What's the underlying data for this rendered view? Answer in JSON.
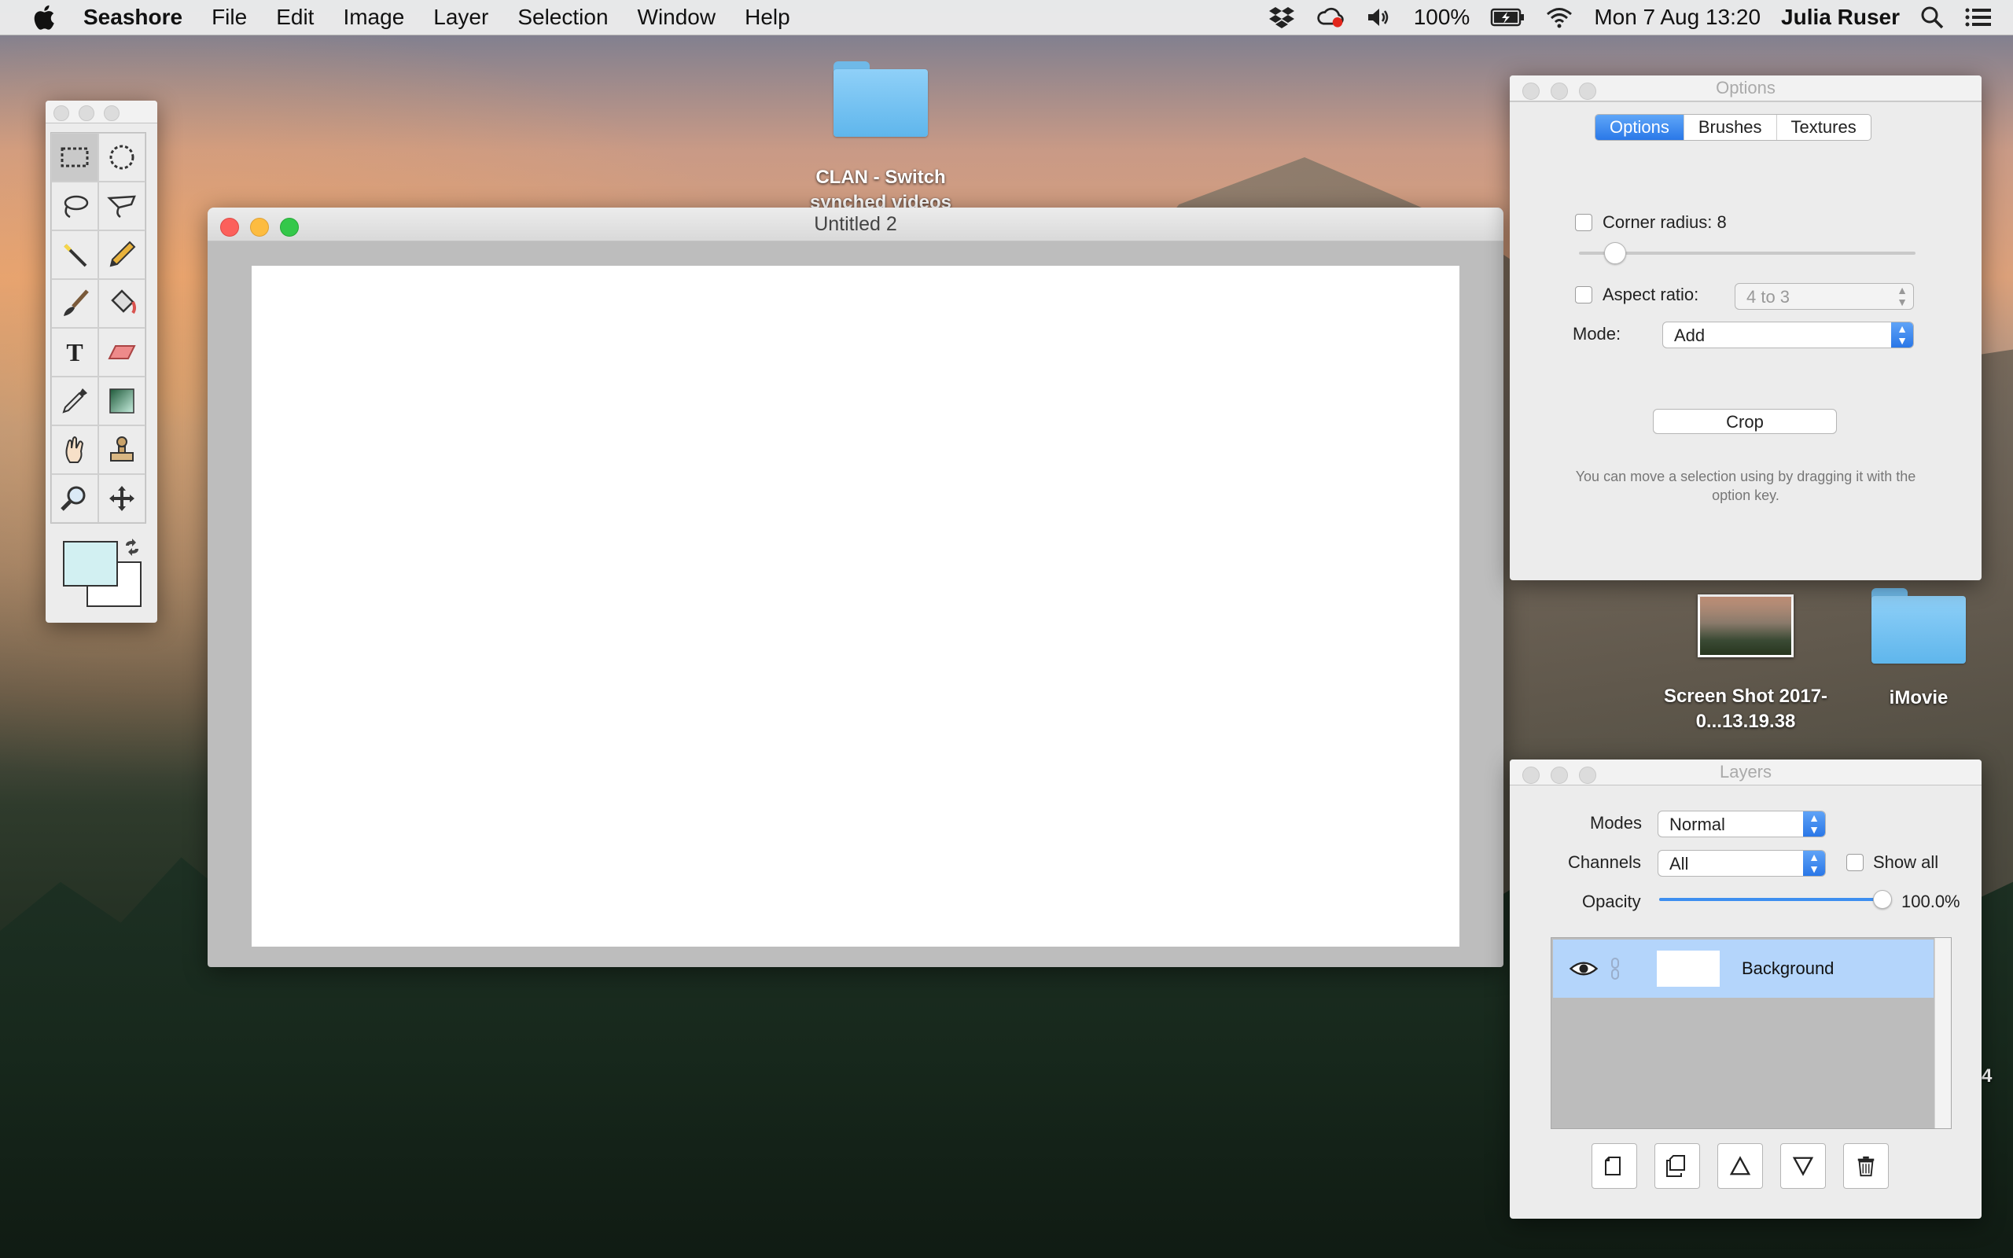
{
  "menubar": {
    "app_name": "Seashore",
    "menus": [
      "File",
      "Edit",
      "Image",
      "Layer",
      "Selection",
      "Window",
      "Help"
    ],
    "status": {
      "battery": "100%",
      "datetime": "Mon 7 Aug  13:20",
      "user": "Julia Ruser"
    }
  },
  "desktop": {
    "icons": [
      {
        "label": "CLAN - Switch synched videos"
      },
      {
        "label": "Screen Shot 2017-0...13.19.38"
      },
      {
        "label": "iMovie"
      }
    ],
    "partial_text": "4"
  },
  "document_window": {
    "title": "Untitled 2"
  },
  "toolbox": {
    "tools": [
      "rect-select",
      "ellipse-select",
      "lasso",
      "polygon-lasso",
      "magic-wand",
      "pencil",
      "brush",
      "bucket-fill",
      "text",
      "eraser",
      "eyedropper",
      "gradient",
      "smudge",
      "clone-stamp",
      "zoom",
      "move"
    ],
    "colors": {
      "foreground": "#d2f0f2",
      "background": "#ffffff"
    }
  },
  "options_panel": {
    "title": "Options",
    "tabs": [
      "Options",
      "Brushes",
      "Textures"
    ],
    "selected_tab": "Options",
    "corner_radius_label": "Corner radius: 8",
    "aspect_ratio_label": "Aspect ratio:",
    "aspect_ratio_value": "4 to 3",
    "mode_label": "Mode:",
    "mode_value": "Add",
    "crop_button": "Crop",
    "hint": "You can move a selection using by dragging it with the option key."
  },
  "layers_panel": {
    "title": "Layers",
    "modes_label": "Modes",
    "modes_value": "Normal",
    "channels_label": "Channels",
    "channels_value": "All",
    "show_all_label": "Show all",
    "opacity_label": "Opacity",
    "opacity_value": "100.0%",
    "opacity_fraction": 1.0,
    "layers": [
      {
        "name": "Background",
        "visible": true,
        "selected": true
      }
    ]
  },
  "colors": {
    "accent": "#2a78e8",
    "layer_selected": "#b4d5fb"
  }
}
